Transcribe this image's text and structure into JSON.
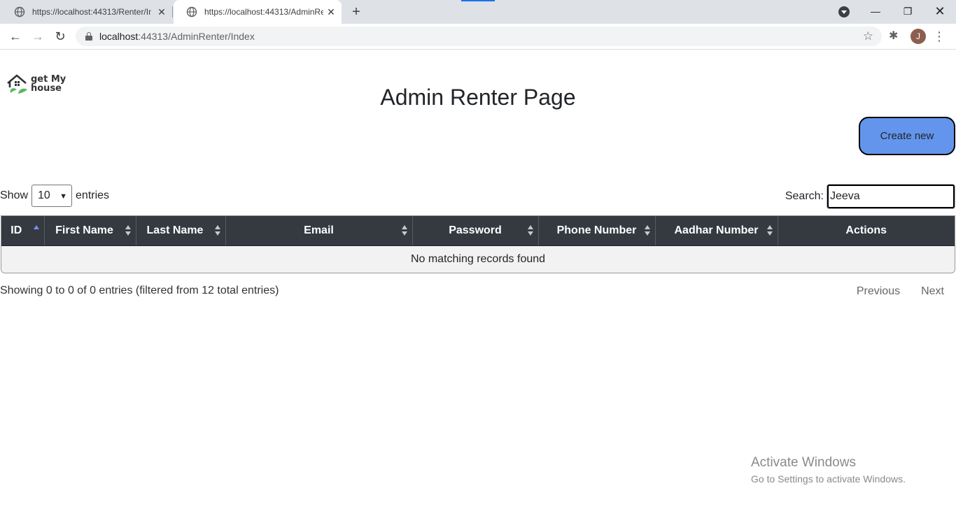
{
  "browser": {
    "tabs": [
      {
        "title": "https://localhost:44313/Renter/In",
        "active": false
      },
      {
        "title": "https://localhost:44313/AdminRe",
        "active": true
      }
    ],
    "new_tab_label": "+",
    "address": {
      "host": "localhost",
      "rest": ":44313/AdminRenter/Index"
    },
    "profile_initial": "J"
  },
  "logo": {
    "line1": "get My",
    "line2": "house"
  },
  "page": {
    "title": "Admin Renter Page",
    "create_button": "Create new"
  },
  "table_controls": {
    "show_label": "Show",
    "page_length": "10",
    "entries_label": "entries",
    "search_label": "Search:",
    "search_value": "Jeeva"
  },
  "table": {
    "columns": [
      "ID",
      "First Name",
      "Last Name",
      "Email",
      "Password",
      "Phone Number",
      "Aadhar Number",
      "Actions"
    ],
    "empty_message": "No matching records found"
  },
  "footer": {
    "info": "Showing 0 to 0 of 0 entries (filtered from 12 total entries)",
    "previous": "Previous",
    "next": "Next"
  },
  "watermark": {
    "line1": "Activate Windows",
    "line2": "Go to Settings to activate Windows."
  }
}
